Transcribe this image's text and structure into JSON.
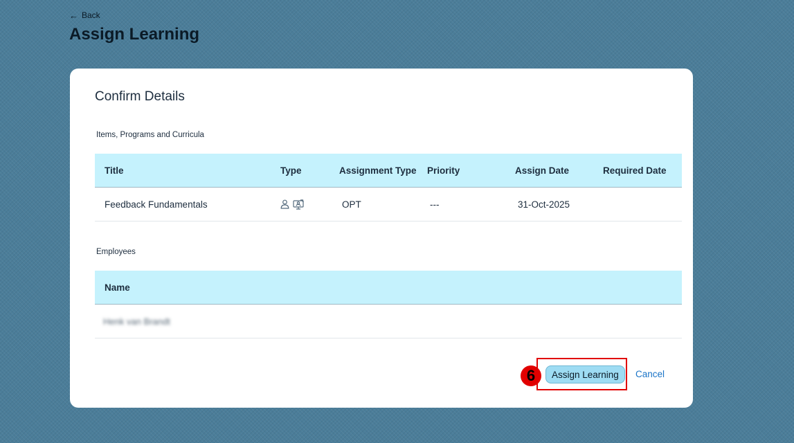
{
  "header": {
    "back_label": "Back",
    "title": "Assign Learning"
  },
  "card": {
    "title": "Confirm Details",
    "items_section_label": "Items, Programs and Curricula",
    "items_columns": {
      "title": "Title",
      "type": "Type",
      "assignment_type": "Assignment Type",
      "priority": "Priority",
      "assign_date": "Assign Date",
      "required_date": "Required Date"
    },
    "items_rows": [
      {
        "title": "Feedback Fundamentals",
        "type_icons": [
          "person-icon",
          "online-course-icon"
        ],
        "assignment_type": "OPT",
        "priority": "---",
        "assign_date": "31-Oct-2025",
        "required_date": ""
      }
    ],
    "employees_section_label": "Employees",
    "employees_columns": {
      "name": "Name"
    },
    "employees_rows": [
      {
        "name": "Henk van Brandt"
      }
    ],
    "actions": {
      "assign_label": "Assign Learning",
      "cancel_label": "Cancel"
    }
  },
  "annotation": {
    "step_number": "6",
    "color": "#e10000"
  },
  "colors": {
    "background": "#4b7d99",
    "table_header": "#c5f2fd",
    "primary_button": "#9edcf3",
    "link": "#1a74c7"
  }
}
